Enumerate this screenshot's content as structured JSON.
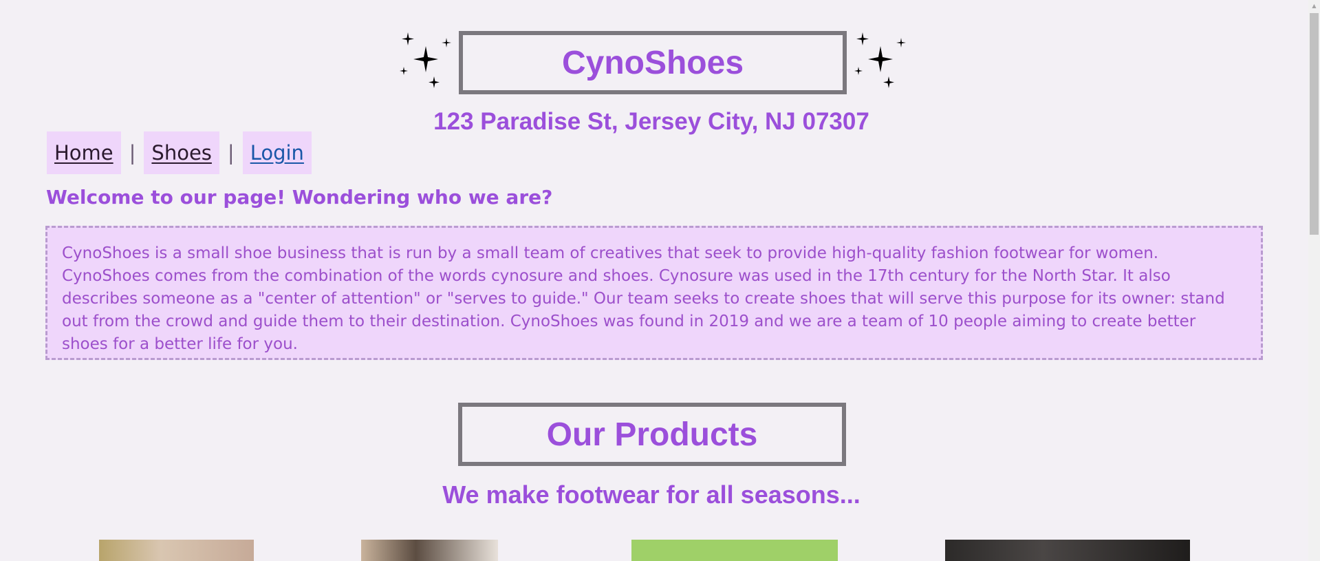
{
  "header": {
    "brand": "CynoShoes",
    "address": "123 Paradise St, Jersey City, NJ 07307"
  },
  "nav": {
    "items": [
      {
        "label": "Home"
      },
      {
        "label": "Shoes"
      },
      {
        "label": "Login"
      }
    ],
    "separator": "|"
  },
  "welcome": {
    "heading": "Welcome to our page! Wondering who we are?",
    "body": "CynoShoes is a small shoe business that is run by a small team of creatives that seek to provide high-quality fashion footwear for women. CynoShoes comes from the combination of the words cynosure and shoes. Cynosure was used in the 17th century for the North Star. It also describes someone as a \"center of attention\" or \"serves to guide.\" Our team seeks to create shoes that will serve this purpose for its owner: stand out from the crowd and guide them to their destination. CynoShoes was found in 2019 and we are a team of 10 people aiming to create better shoes for a better life for you."
  },
  "products": {
    "title": "Our Products",
    "subtitle": "We make footwear for all seasons..."
  },
  "colors": {
    "accent": "#9b4fdb",
    "panel": "#efd6fb",
    "background": "#f3f0f5",
    "frame": "#7b787e"
  },
  "icons": [
    "sparkle-icon",
    "scroll-up-arrow-icon"
  ]
}
